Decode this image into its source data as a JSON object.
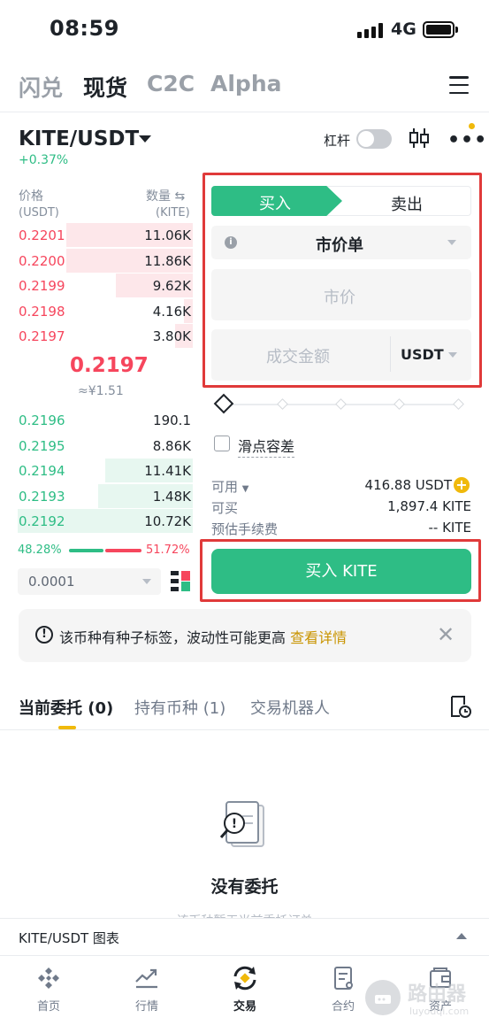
{
  "status": {
    "time": "08:59",
    "network": "4G"
  },
  "top_tabs": [
    {
      "label": "闪兑",
      "active": false
    },
    {
      "label": "现货",
      "active": true
    },
    {
      "label": "C2C",
      "active": false
    },
    {
      "label": "Alpha",
      "active": false
    }
  ],
  "pair": {
    "name": "KITE/USDT",
    "change": "+0.37%",
    "leverage_label": "杠杆"
  },
  "orderbook": {
    "price_header": "价格",
    "price_unit": "(USDT)",
    "qty_header": "数量",
    "qty_unit": "(KITE)",
    "asks": [
      {
        "price": "0.2201",
        "qty": "11.06K",
        "depth": 0.72
      },
      {
        "price": "0.2200",
        "qty": "11.86K",
        "depth": 0.72
      },
      {
        "price": "0.2199",
        "qty": "9.62K",
        "depth": 0.44
      },
      {
        "price": "0.2198",
        "qty": "4.16K",
        "depth": 0.05
      },
      {
        "price": "0.2197",
        "qty": "3.80K",
        "depth": 0.1
      }
    ],
    "last_price": "0.2197",
    "last_price_cny": "≈¥1.51",
    "bids": [
      {
        "price": "0.2196",
        "qty": "190.1",
        "depth": 0.0
      },
      {
        "price": "0.2195",
        "qty": "8.86K",
        "depth": 0.0
      },
      {
        "price": "0.2194",
        "qty": "11.41K",
        "depth": 0.5
      },
      {
        "price": "0.2193",
        "qty": "1.48K",
        "depth": 0.54
      },
      {
        "price": "0.2192",
        "qty": "10.72K",
        "depth": 1.0
      }
    ],
    "buy_ratio": "48.28%",
    "sell_ratio": "51.72%",
    "precision": "0.0001"
  },
  "form": {
    "buy_tab": "买入",
    "sell_tab": "卖出",
    "order_type": "市价单",
    "price_placeholder": "市价",
    "amount_placeholder": "成交金额",
    "amount_unit": "USDT",
    "slippage_label": "滑点容差",
    "available_label": "可用",
    "available_value": "416.88 USDT",
    "buyable_label": "可买",
    "buyable_value": "1,897.4 KITE",
    "fee_label": "预估手续费",
    "fee_value": "-- KITE",
    "buy_button": "买入 KITE"
  },
  "notice": {
    "text": "该币种有种子标签，波动性可能更高 ",
    "link": "查看详情"
  },
  "sub_tabs": [
    {
      "label": "当前委托 (0)",
      "active": true
    },
    {
      "label": "持有币种 (1)",
      "active": false
    },
    {
      "label": "交易机器人",
      "active": false
    }
  ],
  "empty": {
    "title": "没有委托",
    "subtitle": "该币种暂无当前委托订单"
  },
  "chart_bar": {
    "label": "KITE/USDT 图表"
  },
  "nav": [
    {
      "label": "首页",
      "icon": "home-icon",
      "active": false
    },
    {
      "label": "行情",
      "icon": "markets-icon",
      "active": false
    },
    {
      "label": "交易",
      "icon": "trade-icon",
      "active": true
    },
    {
      "label": "合约",
      "icon": "futures-icon",
      "active": false
    },
    {
      "label": "资产",
      "icon": "wallet-icon",
      "active": false
    }
  ],
  "watermark": {
    "text": "路由器",
    "sub": "luyouqi.com"
  },
  "colors": {
    "green": "#2ebd85",
    "red": "#f6465d",
    "yellow": "#f0b90b",
    "highlight": "#e03a3a"
  }
}
